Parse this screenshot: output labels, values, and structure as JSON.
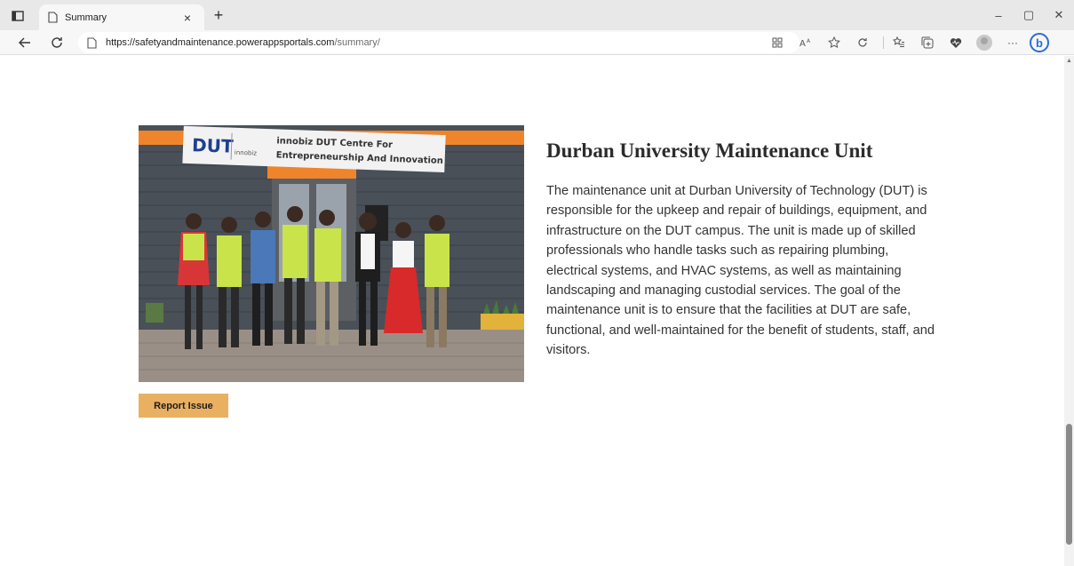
{
  "browser": {
    "tab_title": "Summary",
    "tab_close": "×",
    "new_tab": "+",
    "url_host": "https://safetyandmaintenance.powerappsportals.com",
    "url_path": "/summary/",
    "toolbar_icons": [
      "grid-icon",
      "read-aloud-icon",
      "favorite-star-icon",
      "refresh-sync-icon",
      "favorites-list-icon",
      "collections-icon",
      "heart-health-icon",
      "profile-avatar-icon",
      "more-icon",
      "bing-icon"
    ],
    "more_label": "···",
    "minimize": "–",
    "restore": "▢",
    "close": "✕"
  },
  "main": {
    "image_sign_dut": "DUT",
    "image_sign_brand": "innobiz",
    "image_sign_line1": "innobiz DUT Centre For",
    "image_sign_line2": "Entrepreneurship And Innovation",
    "report_button": "Report Issue",
    "heading": "Durban University Maintenance Unit",
    "description": "The maintenance unit at Durban University of Technology (DUT) is responsible for the upkeep and repair of buildings, equipment, and infrastructure on the DUT campus. The unit is made up of skilled professionals who handle tasks such as repairing plumbing, electrical systems, and HVAC systems, as well as maintaining landscaping and managing custodial services. The goal of the maintenance unit is to ensure that the facilities at DUT are safe, functional, and well-maintained for the benefit of students, staff, and visitors."
  },
  "colors": {
    "accent_button": "#e9b062",
    "sign_orange": "#f0842b",
    "bing_blue": "#2b6cd8"
  }
}
